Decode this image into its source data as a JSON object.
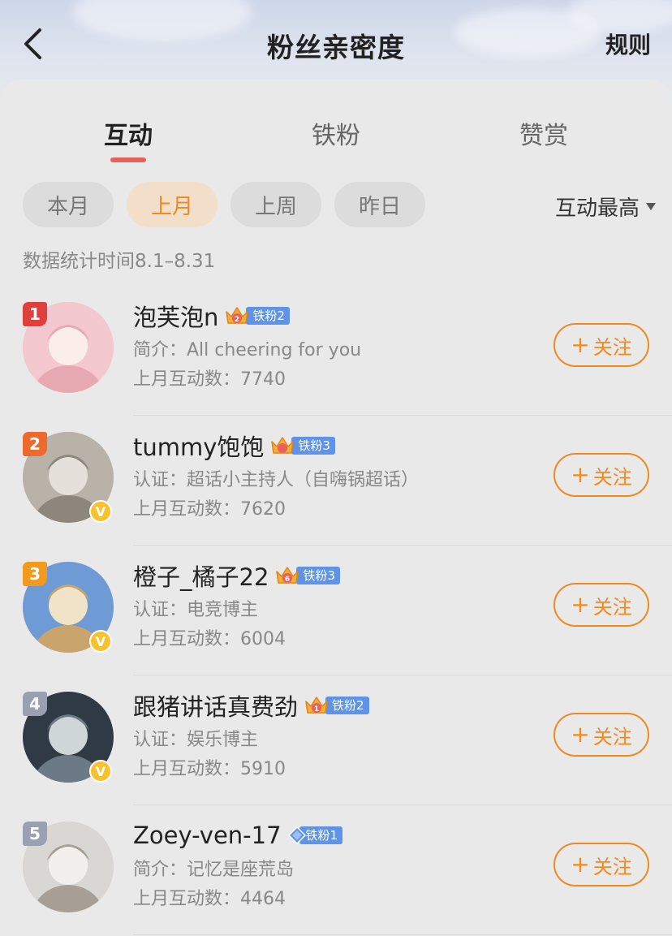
{
  "header": {
    "title": "粉丝亲密度",
    "rules_label": "规则"
  },
  "tabs": [
    {
      "label": "互动",
      "active": true
    },
    {
      "label": "铁粉",
      "active": false
    },
    {
      "label": "赞赏",
      "active": false
    }
  ],
  "filters": [
    {
      "label": "本月",
      "active": false
    },
    {
      "label": "上月",
      "active": true
    },
    {
      "label": "上周",
      "active": false
    },
    {
      "label": "昨日",
      "active": false
    }
  ],
  "sort": {
    "label": "互动最高"
  },
  "stat_time": "数据统计时间8.1–8.31",
  "colors": {
    "accent": "#f08a1e",
    "tab_underline": "#e8605b",
    "fan_badge": "#5e93e8"
  },
  "follow_label": "关注",
  "users": [
    {
      "rank": "1",
      "rank_color": "#e0403b",
      "name": "泡芙泡n",
      "fan_level": "铁粉2",
      "badge_icon": "crown-icon",
      "crown_number": "2",
      "bio": "简介：All cheering for you",
      "count": "上月互动数：7740",
      "verified": false,
      "avatar_colors": [
        "#f3c9cf",
        "#e6a9b1",
        "#fbeee9"
      ]
    },
    {
      "rank": "2",
      "rank_color": "#ee6a2c",
      "name": "tummy饱饱",
      "fan_level": "铁粉3",
      "badge_icon": "crown-icon",
      "crown_number": "",
      "bio": "认证：超话小主持人（自嗨锅超话）",
      "count": "上月互动数：7620",
      "verified": true,
      "avatar_colors": [
        "#b9b2a8",
        "#8d867c",
        "#e5e0d9"
      ]
    },
    {
      "rank": "3",
      "rank_color": "#f19a1e",
      "name": "橙子_橘子22",
      "fan_level": "铁粉3",
      "badge_icon": "crown-icon",
      "crown_number": "6",
      "bio": "认证：电竞博主",
      "count": "上月互动数：6004",
      "verified": true,
      "avatar_colors": [
        "#6e9bd6",
        "#c9a46d",
        "#f1e3c8"
      ]
    },
    {
      "rank": "4",
      "rank_color": "#9aa0b2",
      "name": "跟猪讲话真费劲",
      "fan_level": "铁粉2",
      "badge_icon": "crown-icon",
      "crown_number": "1",
      "bio": "认证：娱乐博主",
      "count": "上月互动数：5910",
      "verified": true,
      "avatar_colors": [
        "#2f3a44",
        "#6b7a86",
        "#cfd6d8"
      ]
    },
    {
      "rank": "5",
      "rank_color": "#9aa0b2",
      "name": "Zoey-ven-17",
      "fan_level": "铁粉1",
      "badge_icon": "diamond-icon",
      "crown_number": "",
      "bio": "简介：记忆是座荒岛",
      "count": "上月互动数：4464",
      "verified": false,
      "avatar_colors": [
        "#d9d7d4",
        "#a79e95",
        "#f2efec"
      ]
    }
  ]
}
